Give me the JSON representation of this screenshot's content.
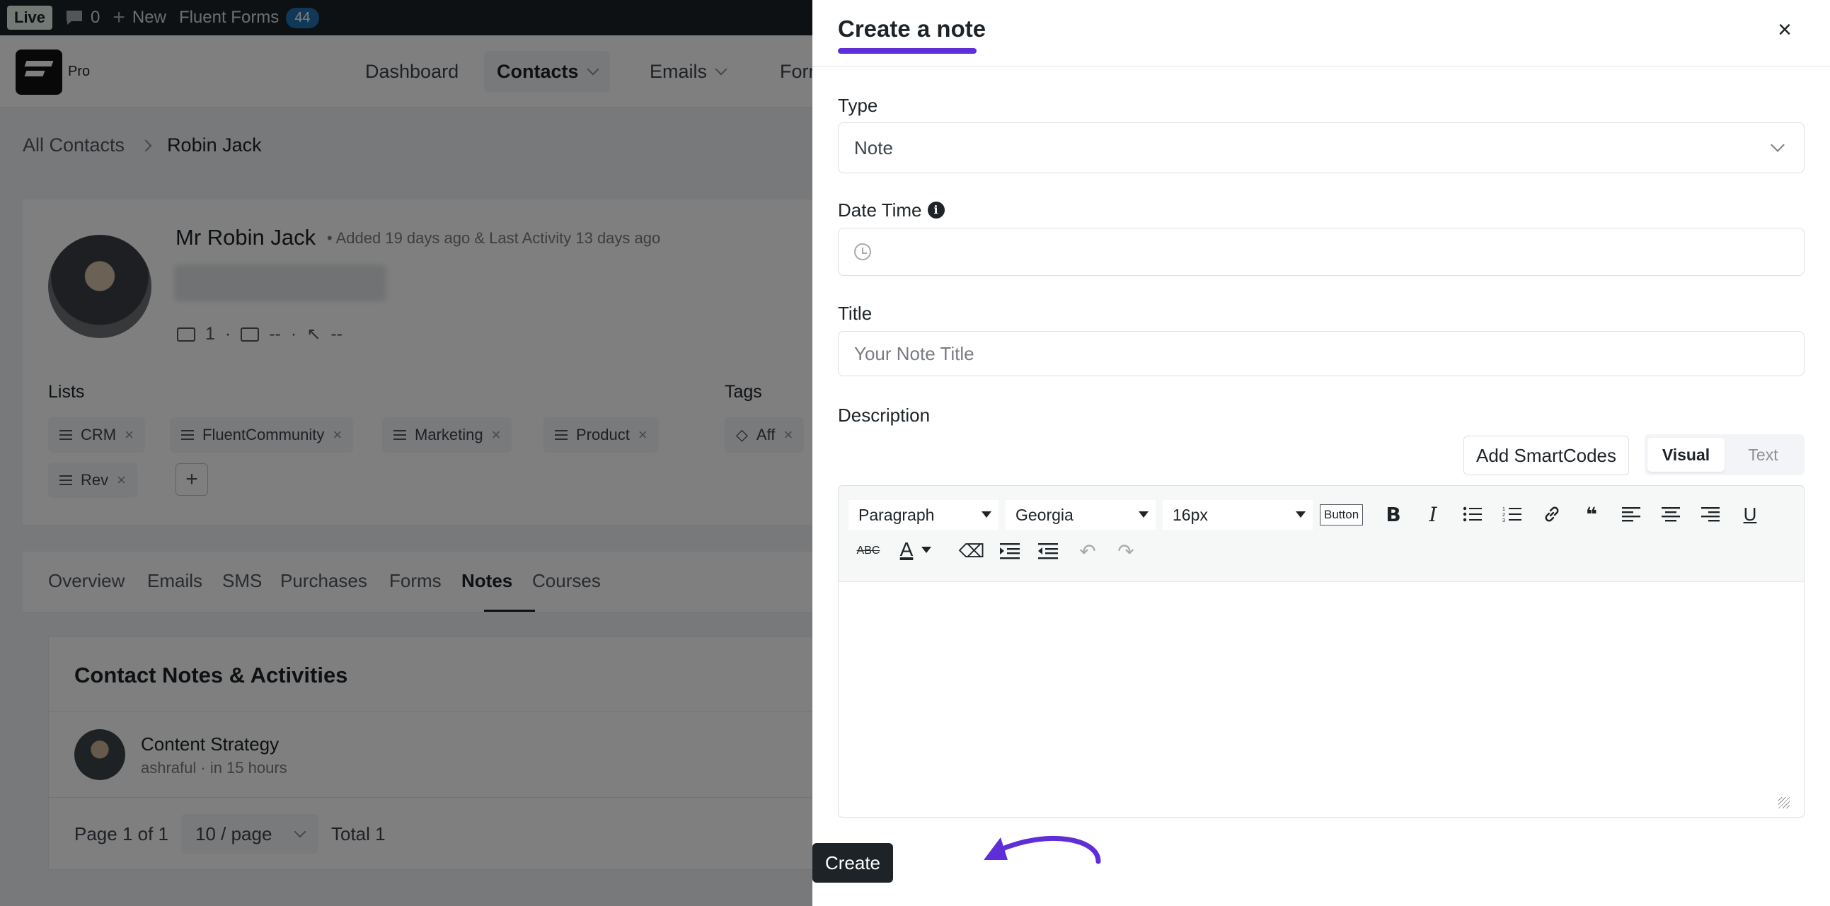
{
  "adminbar": {
    "live": "Live",
    "comments_count": "0",
    "new_label": "New",
    "fluent_forms_label": "Fluent Forms",
    "fluent_forms_count": "44"
  },
  "topnav": {
    "logo_suffix": "Pro",
    "items": [
      {
        "label": "Dashboard"
      },
      {
        "label": "Contacts"
      },
      {
        "label": "Emails"
      },
      {
        "label": "Forms"
      }
    ]
  },
  "breadcrumb": {
    "root": "All Contacts",
    "current": "Robin Jack"
  },
  "profile": {
    "name": "Mr Robin Jack",
    "meta": "• Added 19 days ago & Last Activity 13 days ago",
    "emails_sent": "1",
    "opened": "--",
    "clicked": "--",
    "lists_label": "Lists",
    "tags_label": "Tags",
    "lists": [
      "CRM",
      "FluentCommunity",
      "Marketing",
      "Product",
      "Rev"
    ],
    "tags": [
      "Aff"
    ]
  },
  "tabs": {
    "items": [
      "Overview",
      "Emails",
      "SMS",
      "Purchases",
      "Forms",
      "Notes",
      "Courses"
    ],
    "active": "Notes"
  },
  "notes_section": {
    "title": "Contact Notes & Activities",
    "note": {
      "title": "Content Strategy",
      "meta": "ashraful · in 15 hours"
    },
    "pager": {
      "page_text": "Page 1 of 1",
      "per_page": "10 / page",
      "total": "Total 1"
    }
  },
  "drawer": {
    "title": "Create a note",
    "close": "×",
    "type_label": "Type",
    "type_value": "Note",
    "datetime_label": "Date Time",
    "title_label": "Title",
    "title_placeholder": "Your Note Title",
    "description_label": "Description",
    "add_smartcodes": "Add SmartCodes",
    "mode_visual": "Visual",
    "mode_text": "Text",
    "toolbar": {
      "format": "Paragraph",
      "font": "Georgia",
      "size": "16px",
      "button_label": "Button"
    },
    "create_button": "Create"
  },
  "colors": {
    "accent": "#5e2ed8",
    "dark": "#1d2327"
  }
}
